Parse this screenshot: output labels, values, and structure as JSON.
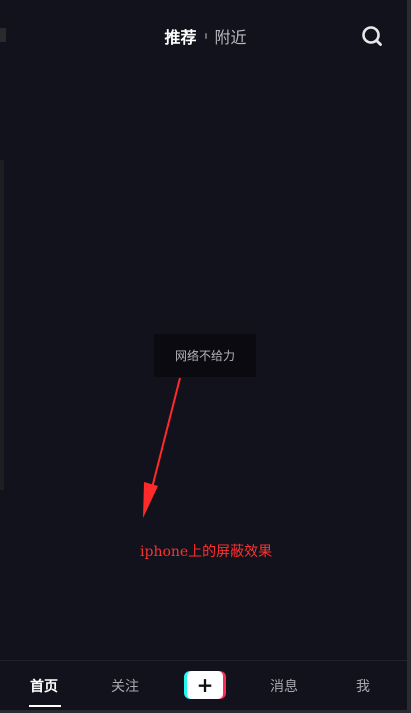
{
  "top_nav": {
    "tabs": [
      {
        "label": "推荐",
        "active": true
      },
      {
        "label": "附近",
        "active": false
      }
    ],
    "search_icon": "search-icon"
  },
  "toast": {
    "message": "网络不给力"
  },
  "annotation": {
    "text": "iphone上的屏蔽效果",
    "color": "#ff3030"
  },
  "bottom_nav": {
    "items": [
      {
        "label": "首页",
        "active": true
      },
      {
        "label": "关注",
        "active": false
      },
      {
        "label": "+",
        "type": "create-button"
      },
      {
        "label": "消息",
        "active": false
      },
      {
        "label": "我",
        "active": false
      }
    ]
  },
  "colors": {
    "background": "#12121c",
    "accent_cyan": "#25f4ee",
    "accent_red": "#fe2c55"
  }
}
